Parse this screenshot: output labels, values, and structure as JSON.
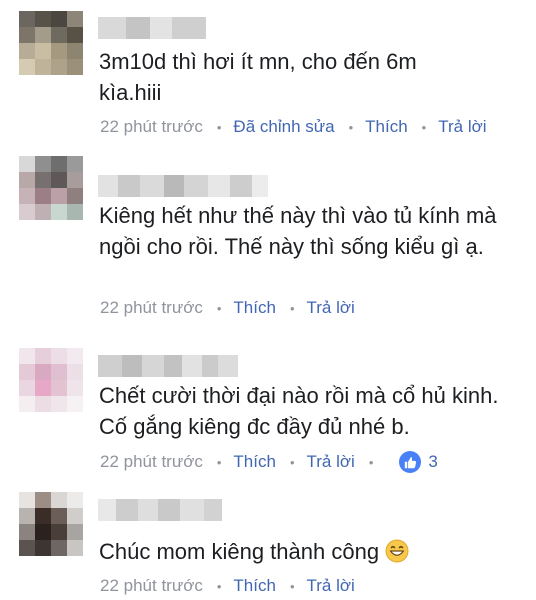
{
  "comments": [
    {
      "text": "3m10d thì hơi ít mn, cho đến 6m kìa.hiii",
      "time": "22 phút trước",
      "edited": "Đã chỉnh sửa",
      "like": "Thích",
      "reply": "Trả lời"
    },
    {
      "text": "Kiêng hết như thế này thì vào tủ kính mà ngồi cho rồi. Thế này thì sống kiểu gì ạ.",
      "time": "22 phút trước",
      "like": "Thích",
      "reply": "Trả lời"
    },
    {
      "text": "Chết cười  thời đại nào rồi mà cổ hủ kinh. Cố gắng kiêng đc đầy đủ nhé b.",
      "time": "22 phút trước",
      "like": "Thích",
      "reply": "Trả lời",
      "reaction_icon": "like-icon",
      "reaction_count": "3"
    },
    {
      "text": "Chúc mom kiêng thành công",
      "time": "22 phút trước",
      "like": "Thích",
      "reply": "Trả lời",
      "emoji_icon": "grinning-face-icon"
    }
  ],
  "colors": {
    "text": "#1c1e21",
    "meta": "#90949c",
    "link": "#4267b2",
    "reaction": "#4880f8"
  }
}
